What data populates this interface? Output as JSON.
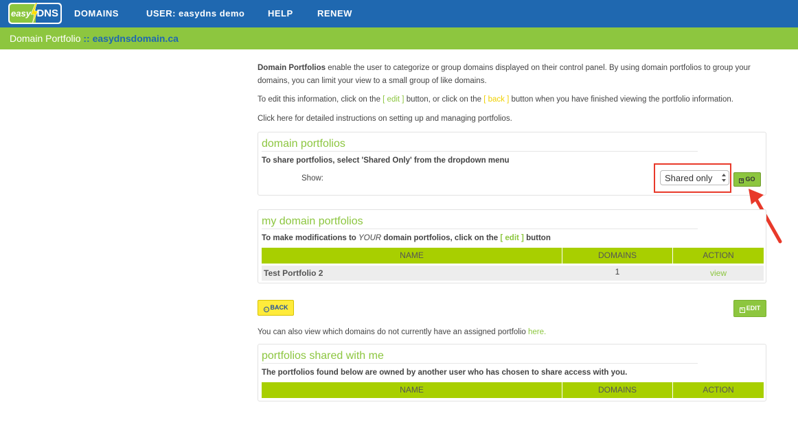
{
  "nav": {
    "logo_easy": "easy",
    "logo_dns": "DNS",
    "items": [
      "DOMAINS",
      "USER: easydns demo",
      "HELP",
      "RENEW"
    ]
  },
  "breadcrumb": {
    "label": "Domain Portfolio",
    "separator": " :: ",
    "domain": "easydnsdomain.ca"
  },
  "intro": {
    "p1_bold": "Domain Portfolios",
    "p1_text": " enable the user to categorize or group domains displayed on their control panel. By using domain portfolios to group your domains, you can limit your view to a small group of like domains.",
    "p2_a": "To edit this information, click on the ",
    "p2_edit": "[ edit ]",
    "p2_b": " button, or click on the ",
    "p2_back": "[ back ]",
    "p2_c": " button when you have finished viewing the portfolio information.",
    "instructions_link": "Click here for detailed instructions on setting up and managing portfolios."
  },
  "domain_portfolios": {
    "title": "domain portfolios",
    "desc": "To share portfolios, select 'Shared Only' from the dropdown menu",
    "show_label": "Show:",
    "selected": "Shared only",
    "go_label": "GO"
  },
  "my_portfolios": {
    "title": "my domain portfolios",
    "desc_a": "To make modifications to ",
    "desc_your": "YOUR",
    "desc_b": " domain portfolios, click on the ",
    "desc_edit": "[ edit ]",
    "desc_c": " button",
    "columns": [
      "NAME",
      "DOMAINS",
      "ACTION"
    ],
    "rows": [
      {
        "name": "Test Portfolio 2",
        "domains": "1",
        "action": "view"
      }
    ]
  },
  "buttons": {
    "back": "BACK",
    "edit": "EDIT"
  },
  "unassigned": {
    "text": "You can also view which domains do not currently have an assigned portfolio ",
    "link": "here."
  },
  "shared_with_me": {
    "title": "portfolios shared with me",
    "desc": "The portfolios found below are owned by another user who has chosen to share access with you.",
    "columns": [
      "NAME",
      "DOMAINS",
      "ACTION"
    ]
  },
  "colors": {
    "nav_blue": "#1f68b0",
    "brand_green": "#8dc63f",
    "table_green": "#a8cf00",
    "highlight_red": "#e8392a",
    "back_yellow": "#ffeb3b"
  }
}
